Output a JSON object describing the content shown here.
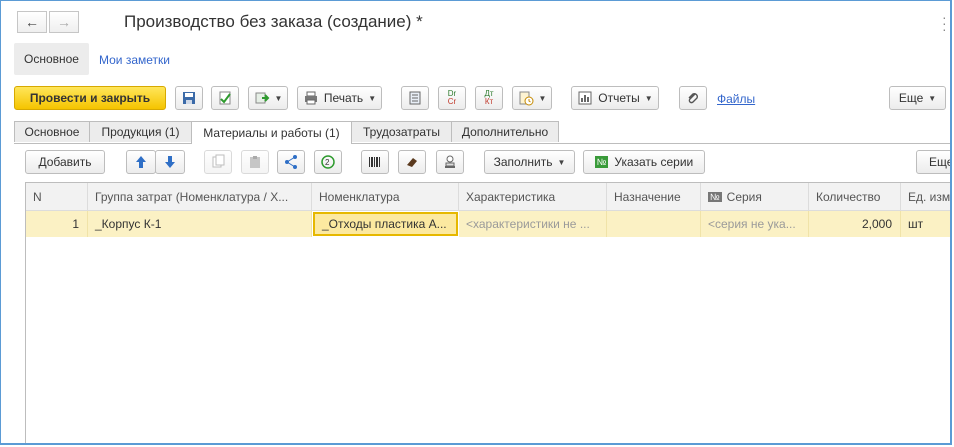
{
  "window": {
    "title": "Производство без заказа (создание) *"
  },
  "form_tabs": {
    "main": "Основное",
    "notes": "Мои заметки"
  },
  "toolbar": {
    "post_close": "Провести и закрыть",
    "print": "Печать",
    "reports": "Отчеты",
    "files": "Файлы",
    "more": "Еще",
    "dt_kt_icon_top": "Dr",
    "dt_kt_icon_bottom": "Cr",
    "dt_kt2_icon_top": "Дт",
    "dt_kt2_icon_bottom": "Кт"
  },
  "doc_tabs": [
    {
      "label": "Основное"
    },
    {
      "label": "Продукция (1)"
    },
    {
      "label": "Материалы и работы (1)"
    },
    {
      "label": "Трудозатраты"
    },
    {
      "label": "Дополнительно"
    }
  ],
  "table_toolbar": {
    "add": "Добавить",
    "fill": "Заполнить",
    "series": "Указать серии",
    "series_icon": "№",
    "more": "Еще"
  },
  "table": {
    "columns": [
      {
        "label": "N"
      },
      {
        "label": "Группа затрат (Номенклатура / Х..."
      },
      {
        "label": "Номенклатура"
      },
      {
        "label": "Характеристика"
      },
      {
        "label": "Назначение"
      },
      {
        "label": "Серия",
        "icon": "№"
      },
      {
        "label": "Количество"
      },
      {
        "label": "Ед. изм."
      }
    ],
    "rows": [
      {
        "n": "1",
        "group": "_Корпус К-1",
        "nomenclature": "_Отходы пластика А...",
        "characteristic": "<характеристики не ...",
        "purpose": "",
        "series": "<серия не ука...",
        "quantity": "2,000",
        "unit": "шт"
      }
    ]
  },
  "colors": {
    "accent_yellow": "#f5c400",
    "row_highlight": "#fbf1c4",
    "link": "#3366cc",
    "frame": "#5b9bd5"
  }
}
